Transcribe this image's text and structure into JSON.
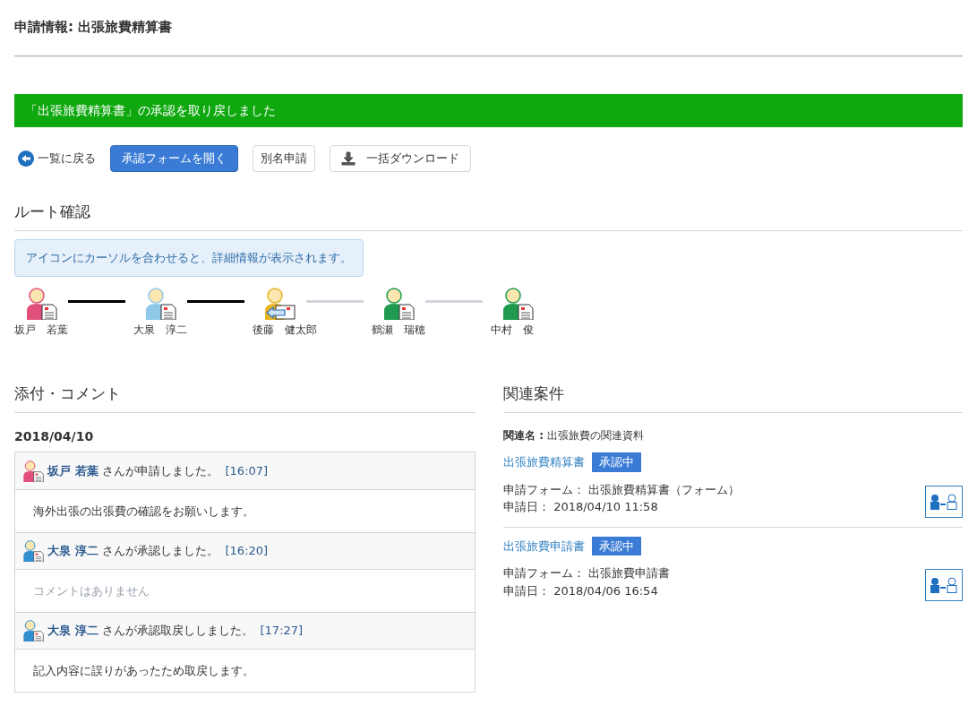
{
  "page_title": "申請情報: 出張旅費精算書",
  "banner": "「出張旅費精算書」の承認を取り戻しました",
  "toolbar": {
    "back_link": "一覧に戻る",
    "buttons": [
      {
        "label": "承認フォームを開く",
        "kind": "primary"
      },
      {
        "label": "別名申請",
        "kind": "plain"
      },
      {
        "label": "一括ダウンロード",
        "kind": "download"
      }
    ]
  },
  "route": {
    "heading": "ルート確認",
    "hint": "アイコンにカーソルを合わせると、詳細情報が表示されます。",
    "steps": [
      {
        "name": "坂戸　若葉",
        "color": "#e0507a",
        "kind": "document"
      },
      {
        "name": "大泉　淳二",
        "color": "#8ec9ea",
        "kind": "document",
        "link_done": true
      },
      {
        "name": "後藤　健太郎",
        "color": "#e8b422",
        "kind": "returned",
        "link_done": true
      },
      {
        "name": "鶴瀬　瑞穂",
        "color": "#1f9a4f",
        "kind": "document",
        "link_done": false
      },
      {
        "name": "中村　俊",
        "color": "#1f9a4f",
        "kind": "document",
        "link_done": false
      }
    ]
  },
  "comments": {
    "heading": "添付・コメント",
    "date": "2018/04/10",
    "entries": [
      {
        "person": "坂戸 若葉",
        "color": "#e0507a",
        "action": "さんが申請しました。",
        "time": "[16:07]",
        "comment": "海外出張の出張費の確認をお願いします。",
        "empty": false
      },
      {
        "person": "大泉 淳二",
        "color": "#2f8fd0",
        "action": "さんが承認しました。",
        "time": "[16:20]",
        "comment": "コメントはありません",
        "empty": true
      },
      {
        "person": "大泉 淳二",
        "color": "#2f8fd0",
        "action": "さんが承認取戻ししました。",
        "time": "[17:27]",
        "comment": "記入内容に誤りがあったため取戻します。",
        "empty": false
      }
    ]
  },
  "related": {
    "heading": "関連案件",
    "name_label": "関連名 :",
    "name_value": "出張旅費の関連資料",
    "items": [
      {
        "title": "出張旅費精算書",
        "status": "承認中",
        "form": "申請フォーム： 出張旅費精算書（フォーム）",
        "date": "申請日： 2018/04/10 11:58"
      },
      {
        "title": "出張旅費申請書",
        "status": "承認中",
        "form": "申請フォーム： 出張旅費申請書",
        "date": "申請日： 2018/04/06 16:54"
      }
    ]
  }
}
